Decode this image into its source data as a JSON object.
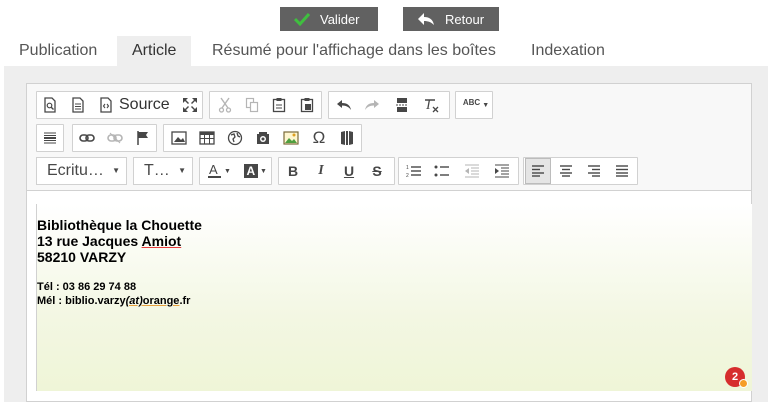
{
  "actions": {
    "validate_label": "Valider",
    "back_label": "Retour"
  },
  "tabs": [
    {
      "label": "Publication"
    },
    {
      "label": "Article"
    },
    {
      "label": "Résumé pour l'affichage dans les boîtes"
    },
    {
      "label": "Indexation"
    }
  ],
  "toolbar": {
    "source_label": "Source",
    "format_combo": "Ecritu…",
    "size_combo": "T…",
    "spell_label": "ABC"
  },
  "content": {
    "line1": "Bibliothèque la Chouette",
    "line2_a": "13 rue Jacques ",
    "line2_b": "Amiot",
    "line3": "58210 VARZY",
    "tel": "Tél : 03 86 29 74 88",
    "mail_a": "Mél : biblio.varzy",
    "mail_b": "(at)",
    "mail_c": "orange",
    "mail_d": ".fr"
  },
  "notification_count": "2",
  "colors": {
    "button_bg": "#616161",
    "active_tab_bg": "#eeeeee",
    "editor_bg": "#eff5d7",
    "badge": "#d62d2d"
  }
}
